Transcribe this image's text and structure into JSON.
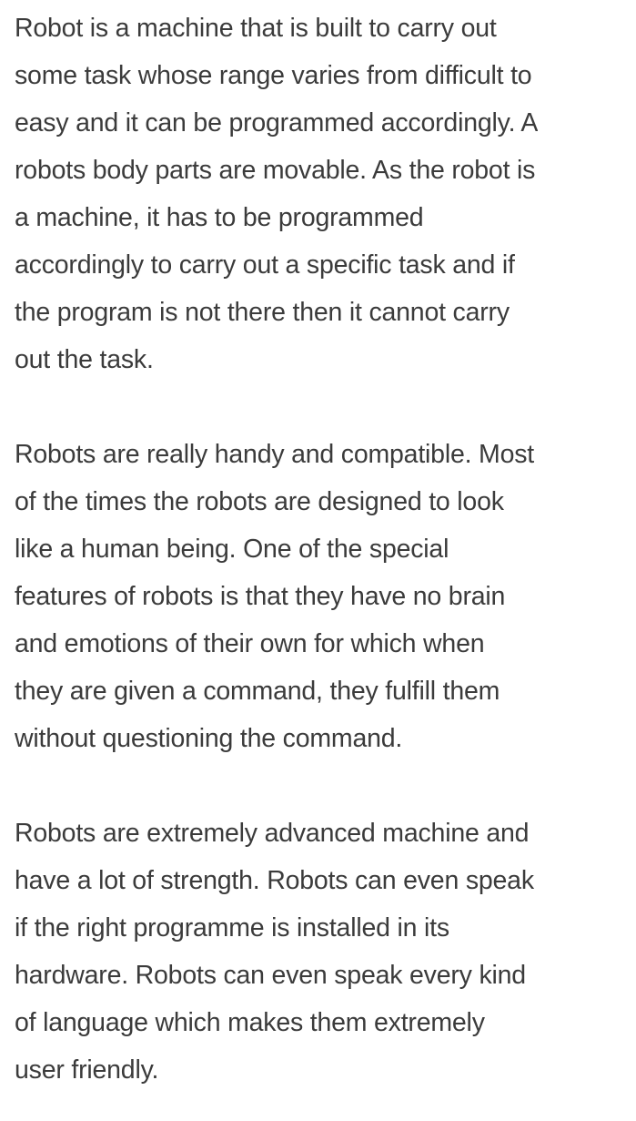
{
  "paragraphs": [
    {
      "lines": [
        "Robot is a machine that is built to carry out",
        "some task whose range varies from difficult to",
        "easy and it can be programmed accordingly. A",
        "robots body parts are movable. As the robot is",
        "a machine, it has to be programmed",
        "accordingly to carry out a specific task and if",
        "the program is not there then it cannot carry",
        "out the task."
      ]
    },
    {
      "lines": [
        "Robots are really handy and compatible. Most",
        "of the times the robots are designed to look",
        "like a human being. One of the special",
        "features of robots is that they have no brain",
        "and emotions of their own for which when",
        "they are given a command, they fulfill them",
        "without questioning the command."
      ]
    },
    {
      "lines": [
        "Robots are extremely advanced machine and",
        "have a lot of strength. Robots can even speak",
        "if the right programme is installed in its",
        "hardware. Robots can even speak every kind",
        "of language which makes them extremely",
        "user friendly."
      ]
    }
  ]
}
